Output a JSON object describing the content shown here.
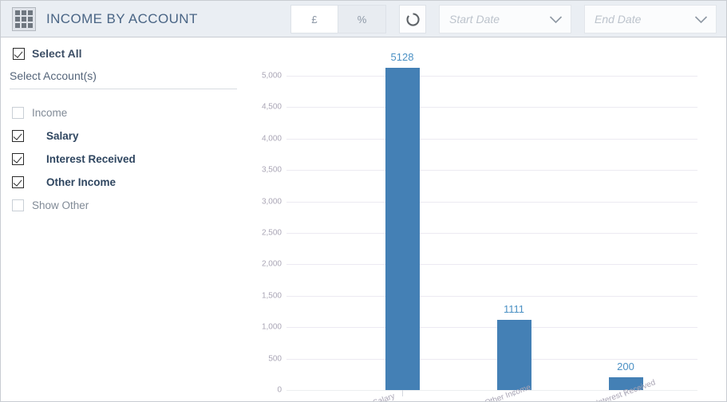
{
  "header": {
    "icon": "grid-icon",
    "title": "INCOME BY ACCOUNT",
    "currency_toggle": {
      "currency_label": "£",
      "percent_label": "%",
      "active": "currency"
    },
    "refresh_icon": "refresh-icon",
    "start_date": {
      "value": "",
      "placeholder": "Start Date"
    },
    "end_date": {
      "value": "",
      "placeholder": "End Date"
    }
  },
  "sidebar": {
    "select_all": {
      "label": "Select All",
      "checked": true
    },
    "section_label": "Select Account(s)",
    "accounts": [
      {
        "label": "Income",
        "checked": false,
        "level": "parent"
      },
      {
        "label": "Salary",
        "checked": true,
        "level": "child"
      },
      {
        "label": "Interest Received",
        "checked": true,
        "level": "child"
      },
      {
        "label": "Other Income",
        "checked": true,
        "level": "child"
      }
    ],
    "show_other": {
      "label": "Show Other",
      "checked": false
    }
  },
  "chart_data": {
    "type": "bar",
    "title": "",
    "xlabel": "",
    "ylabel": "",
    "categories": [
      "Salary",
      "Other Income",
      "Interest Received"
    ],
    "values": [
      5128,
      1111,
      200
    ],
    "value_labels": [
      "5128",
      "1111",
      "200"
    ],
    "ylim": [
      0,
      5000
    ],
    "ytick_values": [
      0,
      500,
      1000,
      1500,
      2000,
      2500,
      3000,
      3500,
      4000,
      4500,
      5000
    ],
    "ytick_labels": [
      "0",
      "500",
      "1,000",
      "1,500",
      "2,000",
      "2,500",
      "3,000",
      "3,500",
      "4,000",
      "4,500",
      "5,000"
    ],
    "grid": true,
    "legend": false,
    "bar_color": "#4480b5",
    "value_label_color": "#4a90c4"
  }
}
